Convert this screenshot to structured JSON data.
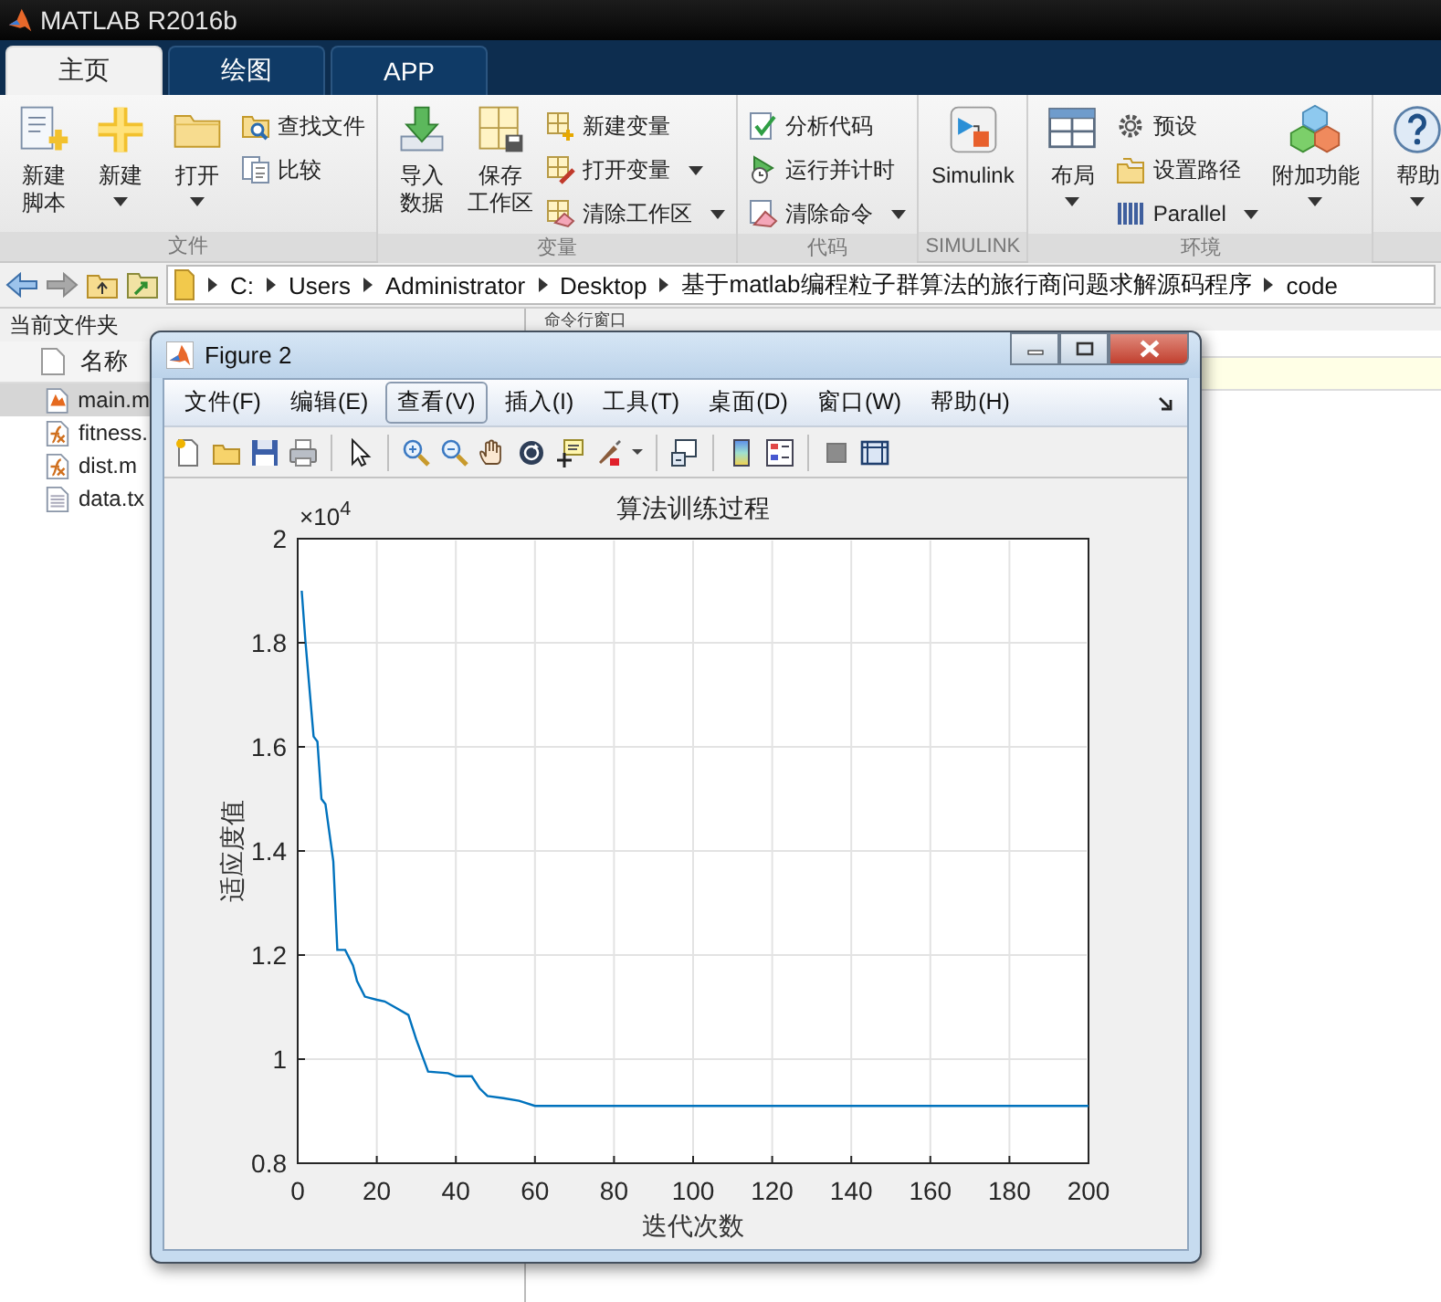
{
  "window": {
    "title": "MATLAB R2016b"
  },
  "tabs": [
    {
      "label": "主页",
      "selected": true
    },
    {
      "label": "绘图",
      "selected": false
    },
    {
      "label": "APP",
      "selected": false
    }
  ],
  "ribbon": {
    "groups": [
      {
        "label": "文件",
        "items": [
          {
            "kind": "tall",
            "label": "新建脚本",
            "dropdown": false
          },
          {
            "kind": "large",
            "label": "新建",
            "dropdown": true
          },
          {
            "kind": "large",
            "label": "打开",
            "dropdown": true
          },
          {
            "kind": "stack",
            "items": [
              {
                "label": "查找文件",
                "dropdown": false
              },
              {
                "label": "比较",
                "dropdown": false
              }
            ]
          }
        ]
      },
      {
        "label": "变量",
        "items": [
          {
            "kind": "tall",
            "label": "导入数据",
            "dropdown": false
          },
          {
            "kind": "tall",
            "label": "保存工作区",
            "dropdown": false
          },
          {
            "kind": "stack",
            "items": [
              {
                "label": "新建变量",
                "dropdown": false
              },
              {
                "label": "打开变量",
                "dropdown": true
              },
              {
                "label": "清除工作区",
                "dropdown": true
              }
            ]
          }
        ]
      },
      {
        "label": "代码",
        "items": [
          {
            "kind": "stack",
            "items": [
              {
                "label": "分析代码",
                "dropdown": false
              },
              {
                "label": "运行并计时",
                "dropdown": false
              },
              {
                "label": "清除命令",
                "dropdown": true
              }
            ]
          }
        ]
      },
      {
        "label": "SIMULINK",
        "items": [
          {
            "kind": "large",
            "label": "Simulink",
            "dropdown": false
          }
        ]
      },
      {
        "label": "环境",
        "items": [
          {
            "kind": "large",
            "label": "布局",
            "dropdown": true
          },
          {
            "kind": "stack",
            "items": [
              {
                "label": "预设",
                "dropdown": false
              },
              {
                "label": "设置路径",
                "dropdown": false
              },
              {
                "label": "Parallel",
                "dropdown": true
              }
            ]
          },
          {
            "kind": "large",
            "label": "附加功能",
            "dropdown": true
          }
        ]
      },
      {
        "items": [
          {
            "kind": "large",
            "label": "帮助",
            "dropdown": true
          }
        ]
      }
    ]
  },
  "address_bar": {
    "path": [
      "C:",
      "Users",
      "Administrator",
      "Desktop",
      "基于matlab编程粒子群算法的旅行商问题求解源码程序",
      "code"
    ]
  },
  "current_folder": {
    "title": "当前文件夹",
    "column": "名称",
    "files": [
      {
        "name": "main.m",
        "kind": "script",
        "selected": true
      },
      {
        "name": "fitness.",
        "kind": "function",
        "selected": false
      },
      {
        "name": "dist.m",
        "kind": "function",
        "selected": false
      },
      {
        "name": "data.tx",
        "kind": "text",
        "selected": false
      }
    ]
  },
  "command_window": {
    "title": "命令行窗口"
  },
  "figure": {
    "title": "Figure 2",
    "menu": [
      {
        "label": "文件(F)",
        "selected": false
      },
      {
        "label": "编辑(E)",
        "selected": false
      },
      {
        "label": "查看(V)",
        "selected": true
      },
      {
        "label": "插入(I)",
        "selected": false
      },
      {
        "label": "工具(T)",
        "selected": false
      },
      {
        "label": "桌面(D)",
        "selected": false
      },
      {
        "label": "窗口(W)",
        "selected": false
      },
      {
        "label": "帮助(H)",
        "selected": false
      }
    ],
    "y_exponent": "×10$^{4}$",
    "chart_data": {
      "type": "line",
      "title": "算法训练过程",
      "xlabel": "迭代次数",
      "ylabel": "适应度值",
      "x": [
        1,
        2,
        4,
        5,
        6,
        7,
        9,
        10,
        12,
        14,
        15,
        17,
        20,
        22,
        24,
        28,
        30,
        33,
        38,
        40,
        44,
        46,
        48,
        52,
        56,
        60,
        100,
        150,
        200
      ],
      "series": [
        {
          "color": "#0072bd",
          "values": [
            1.9,
            1.8,
            1.62,
            1.61,
            1.5,
            1.49,
            1.38,
            1.21,
            1.21,
            1.18,
            1.15,
            1.12,
            1.114,
            1.111,
            1.102,
            1.085,
            1.038,
            0.976,
            0.973,
            0.967,
            0.967,
            0.944,
            0.929,
            0.925,
            0.92,
            0.91,
            0.91,
            0.91,
            0.91
          ]
        }
      ],
      "xlim": [
        0,
        200
      ],
      "ylim": [
        0.8,
        2
      ],
      "xticks": [
        0,
        20,
        40,
        60,
        80,
        100,
        120,
        140,
        160,
        180,
        200
      ],
      "yticks": [
        0.8,
        1,
        1.2,
        1.4,
        1.6,
        1.8,
        2
      ],
      "grid": true
    }
  }
}
